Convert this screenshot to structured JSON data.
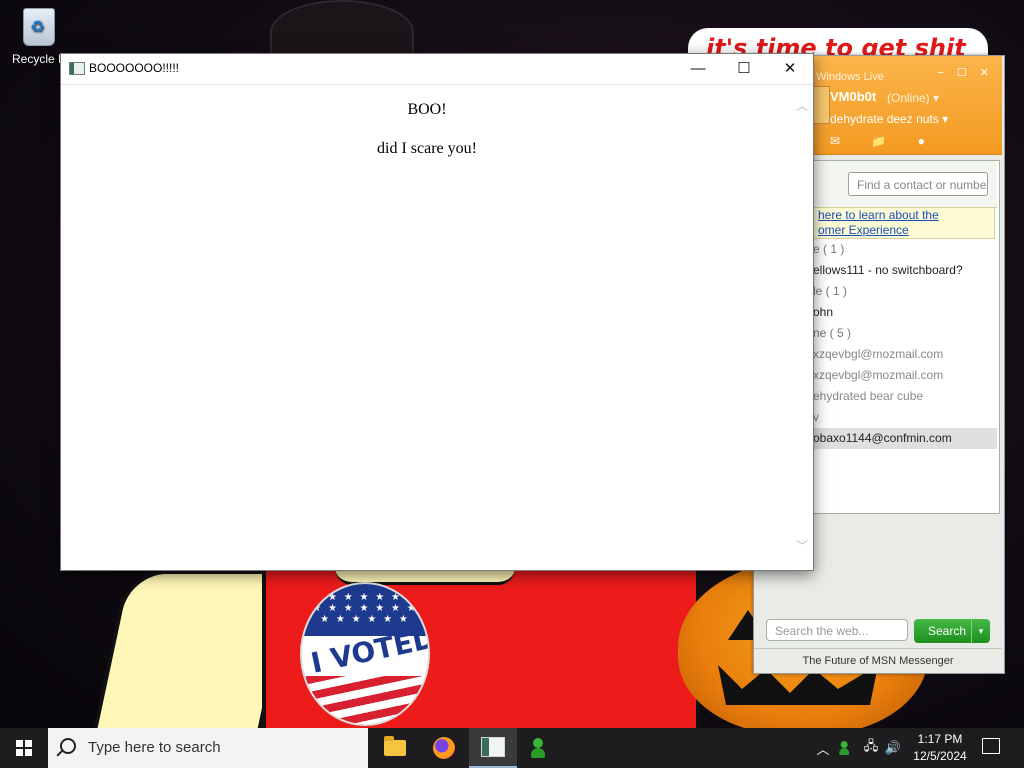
{
  "desktop": {
    "recycle_bin_label": "Recycle B",
    "wallpaper_text": "it's time to get shit",
    "sticker_text": "I VOTED",
    "sticker_stars": "★ ★ ★ ★ ★ ★ ★ ★ ★ ★ ★ ★ ★ ★ ★ ★ ★ ★ ★ ★"
  },
  "boo_window": {
    "title": "BOOOOOOO!!!!!",
    "heading": "BOO!",
    "text": "did I scare you!",
    "minimize_glyph": "—",
    "maximize_glyph": "☐",
    "close_glyph": "✕",
    "scroll_up_glyph": "︿",
    "scroll_down_glyph": "﹀"
  },
  "msn": {
    "brand": "Windows Live",
    "window_controls": "− ☐ ✕",
    "display_name": "VM0b0t",
    "status": "(Online) ▾",
    "personal_message": "dehydrate deez nuts  ▾",
    "toolbar_icons": "✉ 📁 ●",
    "find_placeholder": "Find a contact or number...",
    "banner_line1": "here to learn about the",
    "banner_line2": "omer Experience",
    "contacts": [
      {
        "text": "e ( 1 )",
        "kind": "group"
      },
      {
        "text": "ellows111 - no switchboard?",
        "kind": "contact"
      },
      {
        "text": "le ( 1 )",
        "kind": "group"
      },
      {
        "text": "ohn",
        "kind": "contact"
      },
      {
        "text": "ne ( 5 )",
        "kind": "group"
      },
      {
        "text": "xzqevbgl@mozmail.com",
        "kind": "gray"
      },
      {
        "text": "xzqevbgl@mozmail.com",
        "kind": "gray"
      },
      {
        "text": "ehydrated bear cube",
        "kind": "gray"
      },
      {
        "text": "v",
        "kind": "gray"
      },
      {
        "text": "obaxo1144@confmin.com",
        "kind": "selected"
      }
    ],
    "search_placeholder": "Search the web...",
    "search_button": "Search",
    "search_dropdown": "▾",
    "footer": "The Future of MSN Messenger"
  },
  "taskbar": {
    "search_placeholder": "Type here to search",
    "time": "1:17 PM",
    "date": "12/5/2024",
    "tray_chevron": "︿",
    "tray_network": "🖧",
    "tray_volume": "🔊"
  },
  "colors": {
    "msn_header": "#f39a22",
    "taskbar": "#1d1d1f",
    "search_green": "#1d8f1d"
  }
}
